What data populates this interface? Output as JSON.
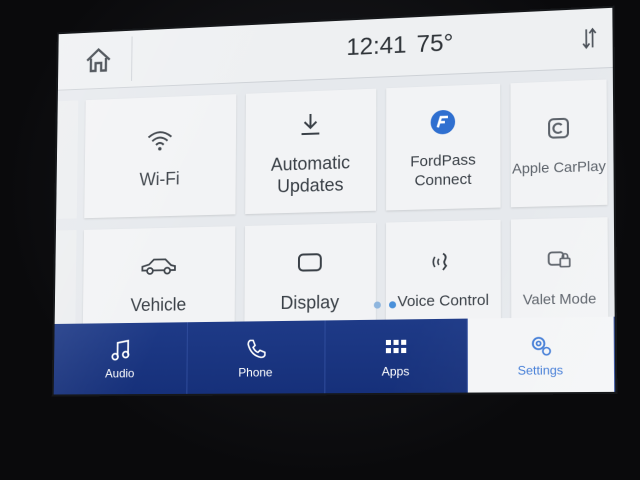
{
  "status_bar": {
    "time": "12:41",
    "temperature": "75°",
    "home_icon": "home-icon",
    "sort_icon": "sort-arrows-icon"
  },
  "tiles": [
    {
      "label": "Wi-Fi",
      "icon": "wifi-icon"
    },
    {
      "label": "Automatic Updates",
      "icon": "download-icon"
    },
    {
      "label": "FordPass Connect",
      "icon": "fordpass-icon"
    },
    {
      "label": "Apple CarPlay",
      "icon": "carplay-icon"
    },
    {
      "label": "Vehicle",
      "icon": "car-icon"
    },
    {
      "label": "Display",
      "icon": "display-icon"
    },
    {
      "label": "Voice Control",
      "icon": "voice-control-icon"
    },
    {
      "label": "Valet Mode",
      "icon": "valet-mode-icon"
    }
  ],
  "pagination": {
    "pages": 2,
    "current": 2
  },
  "nav": [
    {
      "label": "Audio",
      "icon": "music-note-icon",
      "active": false
    },
    {
      "label": "Phone",
      "icon": "phone-icon",
      "active": false
    },
    {
      "label": "Apps",
      "icon": "apps-grid-icon",
      "active": false
    },
    {
      "label": "Settings",
      "icon": "settings-gear-icon",
      "active": true
    }
  ],
  "colors": {
    "nav_bar": "#1e3a87",
    "accent": "#3f7ad6",
    "tile": "#f2f3f5",
    "screen_bg": "#e6e9ed"
  }
}
